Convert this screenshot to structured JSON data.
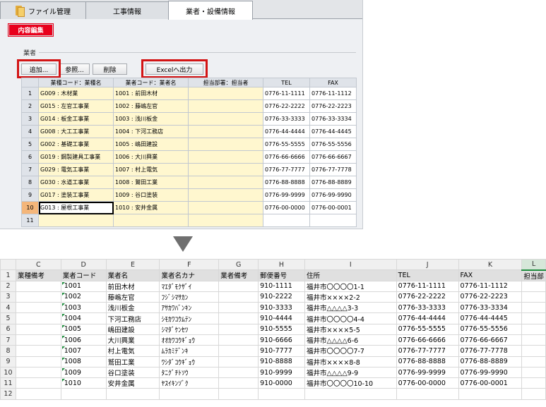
{
  "app": {
    "tabs": [
      {
        "label": "ファイル管理",
        "icon": "folder-icon"
      },
      {
        "label": "工事情報"
      },
      {
        "label": "業者・設備情報"
      }
    ],
    "edit_button": "内容編集",
    "group_label": "業者",
    "toolbar": {
      "add": "追加...",
      "ref": "参照...",
      "delete": "削除",
      "excel": "Excelへ出力"
    },
    "grid": {
      "headers": [
        "業種コード：業種名",
        "業者コード：業者名",
        "担当部署：担当者",
        "TEL",
        "FAX"
      ],
      "rows": [
        {
          "n": "1",
          "trade": "G009 : 木材業",
          "vendor": "1001 : 前田木材",
          "dept": "",
          "tel": "0776-11-1111",
          "fax": "0776-11-1112"
        },
        {
          "n": "2",
          "trade": "G015 : 左官工事業",
          "vendor": "1002 : 藤嶋左官",
          "dept": "",
          "tel": "0776-22-2222",
          "fax": "0776-22-2223"
        },
        {
          "n": "3",
          "trade": "G014 : 板金工事業",
          "vendor": "1003 : 浅川板金",
          "dept": "",
          "tel": "0776-33-3333",
          "fax": "0776-33-3334"
        },
        {
          "n": "4",
          "trade": "G008 : 大工工事業",
          "vendor": "1004 : 下河工務店",
          "dept": "",
          "tel": "0776-44-4444",
          "fax": "0776-44-4445"
        },
        {
          "n": "5",
          "trade": "G002 : 基礎工事業",
          "vendor": "1005 : 嶋田建設",
          "dept": "",
          "tel": "0776-55-5555",
          "fax": "0776-55-5556"
        },
        {
          "n": "6",
          "trade": "G019 : 鋼製建具工事業",
          "vendor": "1006 : 大川興業",
          "dept": "",
          "tel": "0776-66-6666",
          "fax": "0776-66-6667"
        },
        {
          "n": "7",
          "trade": "G029 : 電気工事業",
          "vendor": "1007 : 村上電気",
          "dept": "",
          "tel": "0776-77-7777",
          "fax": "0776-77-7778"
        },
        {
          "n": "8",
          "trade": "G030 : 水道工事業",
          "vendor": "1008 : 鷲田工業",
          "dept": "",
          "tel": "0776-88-8888",
          "fax": "0776-88-8889"
        },
        {
          "n": "9",
          "trade": "G017 : 塗装工事業",
          "vendor": "1009 : 谷口塗装",
          "dept": "",
          "tel": "0776-99-9999",
          "fax": "0776-99-9990"
        },
        {
          "n": "10",
          "trade": "G013 : 屋根工事業",
          "vendor": "1010 : 安井金属",
          "dept": "",
          "tel": "0776-00-0000",
          "fax": "0776-00-0001"
        },
        {
          "n": "11",
          "trade": "",
          "vendor": "",
          "dept": "",
          "tel": "",
          "fax": ""
        }
      ]
    }
  },
  "sheet": {
    "col_letters": [
      "C",
      "D",
      "E",
      "F",
      "G",
      "H",
      "I",
      "J",
      "K",
      "L"
    ],
    "headers": [
      "業種備考",
      "業者コード",
      "業者名",
      "業者名カナ",
      "業者備考",
      "郵便番号",
      "住所",
      "TEL",
      "FAX",
      "担当部"
    ],
    "rows": [
      {
        "n": "2",
        "code": "1001",
        "name": "前田木材",
        "kana": "ﾏｴﾀﾞﾓｸｻﾞｲ",
        "zip": "910-1111",
        "addr": "福井市〇〇〇〇1-1",
        "tel": "0776-11-1111",
        "fax": "0776-11-1112"
      },
      {
        "n": "3",
        "code": "1002",
        "name": "藤嶋左官",
        "kana": "ﾌｼﾞｼﾏｻｶﾝ",
        "zip": "910-2222",
        "addr": "福井市××××2-2",
        "tel": "0776-22-2222",
        "fax": "0776-22-2223"
      },
      {
        "n": "4",
        "code": "1003",
        "name": "浅川板金",
        "kana": "ｱｻｶﾜﾊﾞﾝｷﾝ",
        "zip": "910-3333",
        "addr": "福井市△△△△3-3",
        "tel": "0776-33-3333",
        "fax": "0776-33-3334"
      },
      {
        "n": "5",
        "code": "1004",
        "name": "下河工務店",
        "kana": "ｼﾓｶﾜｺｳﾑﾃﾝ",
        "zip": "910-4444",
        "addr": "福井市〇〇〇〇4-4",
        "tel": "0776-44-4444",
        "fax": "0776-44-4445"
      },
      {
        "n": "6",
        "code": "1005",
        "name": "嶋田建設",
        "kana": "ｼﾏﾀﾞｹﾝｾﾂ",
        "zip": "910-5555",
        "addr": "福井市××××5-5",
        "tel": "0776-55-5555",
        "fax": "0776-55-5556"
      },
      {
        "n": "7",
        "code": "1006",
        "name": "大川興業",
        "kana": "ｵｵｶﾜｺｳｷﾞｮｳ",
        "zip": "910-6666",
        "addr": "福井市△△△△6-6",
        "tel": "0776-66-6666",
        "fax": "0776-66-6667"
      },
      {
        "n": "8",
        "code": "1007",
        "name": "村上電気",
        "kana": "ﾑﾗｶﾐﾃﾞﾝｷ",
        "zip": "910-7777",
        "addr": "福井市〇〇〇〇7-7",
        "tel": "0776-77-7777",
        "fax": "0776-77-7778"
      },
      {
        "n": "9",
        "code": "1008",
        "name": "鷲田工業",
        "kana": "ﾜｼﾀﾞｺｳｷﾞｮｳ",
        "zip": "910-8888",
        "addr": "福井市××××8-8",
        "tel": "0776-88-8888",
        "fax": "0776-88-8889"
      },
      {
        "n": "10",
        "code": "1009",
        "name": "谷口塗装",
        "kana": "ﾀﾆｸﾞﾁﾄｿｳ",
        "zip": "910-9999",
        "addr": "福井市△△△△9-9",
        "tel": "0776-99-9999",
        "fax": "0776-99-9990"
      },
      {
        "n": "11",
        "code": "1010",
        "name": "安井金属",
        "kana": "ﾔｽｲｷﾝｿﾞｸ",
        "zip": "910-0000",
        "addr": "福井市〇〇〇〇10-10",
        "tel": "0776-00-0000",
        "fax": "0776-00-0001"
      },
      {
        "n": "12",
        "code": "",
        "name": "",
        "kana": "",
        "zip": "",
        "addr": "",
        "tel": "",
        "fax": ""
      }
    ]
  },
  "colors": {
    "accent_red": "#e8001c",
    "highlight_box": "#d31414",
    "excel_green": "#1e8c3c"
  }
}
